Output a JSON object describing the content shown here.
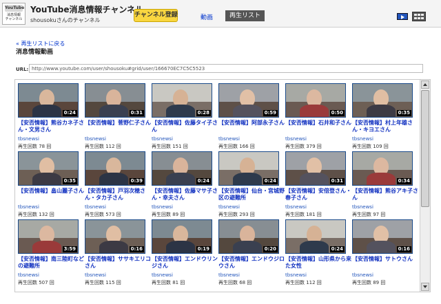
{
  "header": {
    "logo_top": "YouTube",
    "logo_line1": "消息情報",
    "logo_line2": "チャンネル",
    "channel_title": "YouTube消息情報チャンネル",
    "channel_user": "shousoku",
    "channel_suffix": "さんのチャンネル",
    "subscribe_label": "チャンネル登録",
    "nav_video": "動画",
    "nav_playlist": "再生リスト"
  },
  "page": {
    "back_link": "« 再生リストに戻る",
    "section_title": "消息情報動画",
    "url_label": "URL:",
    "url_value": "http://www.youtube.com/user/shousoku#grid/user/166670EC7C5C5523"
  },
  "videos": [
    {
      "title": "【安否情報】熊谷カネ子さん・文男さん",
      "user": "tbsnewsi",
      "views": "再生回数 78 回",
      "duration": "0:24"
    },
    {
      "title": "【安否情報】菅野仁子さん",
      "user": "tbsnewsi",
      "views": "再生回数 112 回",
      "duration": "0:31"
    },
    {
      "title": "【安否情報】佐藤タイ子さん",
      "user": "tbsnewsi",
      "views": "再生回数 151 回",
      "duration": "0:28"
    },
    {
      "title": "【安否情報】阿部永子さん",
      "user": "tbsnewsi",
      "views": "再生回数 166 回",
      "duration": "0:59"
    },
    {
      "title": "【安否情報】石井和子さん",
      "user": "tbsnewsi",
      "views": "再生回数 379 回",
      "duration": "0:50"
    },
    {
      "title": "【安否情報】村上年雄さん・キヨエさん",
      "user": "tbsnewsi",
      "views": "再生回数 109 回",
      "duration": "0:35"
    },
    {
      "title": "【安否情報】畠山麗子さん",
      "user": "tbsnewsi",
      "views": "再生回数 132 回",
      "duration": "0:35"
    },
    {
      "title": "【安否情報】戸羽次穂さん・タカ子さん",
      "user": "tbsnewsi",
      "views": "再生回数 573 回",
      "duration": "0:39"
    },
    {
      "title": "【安否情報】佐藤マサ子さん・幸夫さん",
      "user": "tbsnewsi",
      "views": "再生回数 89 回",
      "duration": "0:24"
    },
    {
      "title": "【安否情報】仙台・宮城野区の避難所",
      "user": "tbsnewsi",
      "views": "再生回数 293 回",
      "duration": "0:24"
    },
    {
      "title": "【安否情報】安倍登さん・春子さん",
      "user": "tbsnewsi",
      "views": "再生回数 181 回",
      "duration": "0:31"
    },
    {
      "title": "【安否情報】熊谷アキ子さん",
      "user": "tbsnewsi",
      "views": "再生回数 97 回",
      "duration": "0:34"
    },
    {
      "title": "【安否情報】南三陸町などの避難所",
      "user": "tbsnewsi",
      "views": "再生回数 507 回",
      "duration": "3:59"
    },
    {
      "title": "【安否情報】ササキエリコさん",
      "user": "tbsnewsi",
      "views": "再生回数 115 回",
      "duration": "0:16"
    },
    {
      "title": "【安否情報】エンドウリンジさん",
      "user": "tbsnewsi",
      "views": "再生回数 81 回",
      "duration": "0:19"
    },
    {
      "title": "【安否情報】エンドウジロウさん",
      "user": "tbsnewsi",
      "views": "再生回数 68 回",
      "duration": "0:20"
    },
    {
      "title": "【安否情報】山形県から来た女性",
      "user": "tbsnewsi",
      "views": "再生回数 112 回",
      "duration": "0:24"
    },
    {
      "title": "【安否情報】サトウさん",
      "user": "tbsnewsi",
      "views": "再生回数 89 回",
      "duration": "0:16"
    }
  ]
}
